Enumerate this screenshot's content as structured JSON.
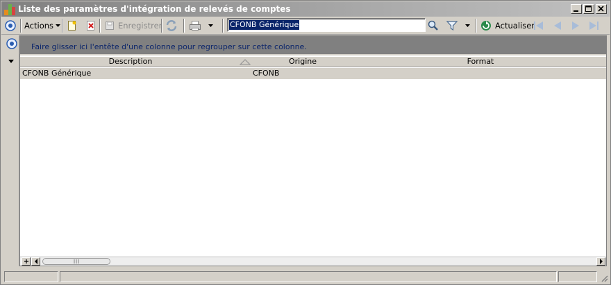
{
  "window": {
    "title": "Liste des paramètres d'intégration de relevés de comptes",
    "buttons": [
      "minimize-icon",
      "maximize-icon",
      "close-icon"
    ]
  },
  "toolbar": {
    "actions_label": "Actions",
    "save_label": "Enregistrer",
    "search_value": "CFONB Générique",
    "refresh_label": "Actualiser",
    "icons": [
      "nav-circle-icon",
      "new-document-icon",
      "delete-icon",
      "save-icon",
      "sync-icon",
      "print-icon",
      "search-icon",
      "filter-icon",
      "refresh-icon",
      "first-record-icon",
      "previous-record-icon",
      "next-record-icon",
      "last-record-icon"
    ]
  },
  "grid": {
    "group_hint": "Faire glisser ici l'entête d'une colonne pour regrouper sur cette colonne.",
    "columns": [
      "Description",
      "Origine",
      "Format"
    ],
    "sorted_column": "Description",
    "sort_direction": "ascending",
    "rows": [
      {
        "description": "CFONB Générique",
        "origine": "CFONB",
        "format": ""
      }
    ]
  },
  "colors": {
    "window_bg": "#d4d0c8",
    "group_panel": "#808080",
    "group_text": "#0a246a",
    "selection": "#0a246a"
  }
}
